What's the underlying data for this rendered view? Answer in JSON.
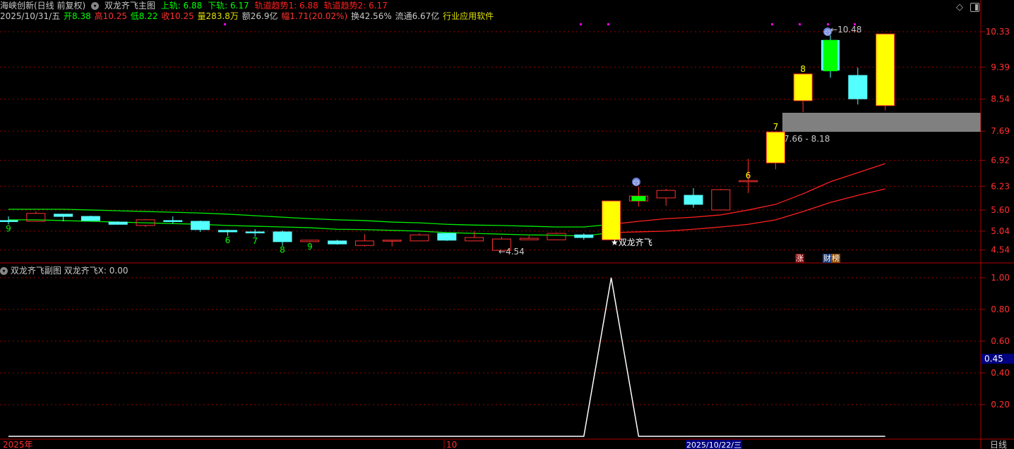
{
  "header": {
    "stock": "海峡创新(日线 前复权)",
    "indicator": "双龙齐飞主图",
    "upper": "上轨: 6.88",
    "lower": "下轨: 6.17",
    "trend1": "轨道趋势1: 6.88",
    "trend2": "轨道趋势2: 6.17",
    "date": "2025/10/31/五",
    "open": "开8.38",
    "high": "高10.25",
    "low": "低8.22",
    "close": "收10.25",
    "volume": "量283.8万",
    "amount": "额26.9亿",
    "change": "幅1.71(20.02%)",
    "turnover": "换42.56%",
    "float": "流通6.67亿",
    "industry": "行业应用软件"
  },
  "sub": {
    "title": "双龙齐飞副图",
    "value": "双龙齐飞X: 0.00"
  },
  "price_axis": [
    "10.33",
    "9.39",
    "8.54",
    "7.69",
    "6.92",
    "6.23",
    "5.60",
    "5.04",
    "4.54"
  ],
  "sub_axis": [
    "1.00",
    "0.80",
    "0.60",
    "0.40",
    "0.20"
  ],
  "sub_cursor": "0.45",
  "annotations": {
    "high_mark": "10.48",
    "low_mark": "4.54",
    "zone": "7.66 - 8.18",
    "signal": "★双龙齐飞",
    "tag_zhang": "涨",
    "tag_cai": "财",
    "tag_bang": "榜"
  },
  "time_axis": {
    "year": "2025年",
    "month": "10",
    "cursor_date": "2025/10/22/三",
    "period": "日线"
  },
  "colors": {
    "up": "#ff3030",
    "down": "#54ffff",
    "limit": "#ffff00",
    "special": "#00ff00",
    "ma_green": "#00ee00",
    "ma_red": "#ff2020"
  },
  "chart_data": {
    "type": "candlestick",
    "candles": [
      {
        "o": 5.32,
        "c": 5.3,
        "h": 5.43,
        "l": 5.22,
        "s": "down",
        "label": "9"
      },
      {
        "o": 5.3,
        "c": 5.51,
        "h": 5.56,
        "l": 5.3,
        "s": "up"
      },
      {
        "o": 5.49,
        "c": 5.43,
        "h": 5.49,
        "l": 5.3,
        "s": "down"
      },
      {
        "o": 5.43,
        "c": 5.32,
        "h": 5.45,
        "l": 5.32,
        "s": "down"
      },
      {
        "o": 5.28,
        "c": 5.22,
        "h": 5.3,
        "l": 5.22,
        "s": "down"
      },
      {
        "o": 5.19,
        "c": 5.34,
        "h": 5.36,
        "l": 5.15,
        "s": "up"
      },
      {
        "o": 5.32,
        "c": 5.3,
        "h": 5.43,
        "l": 5.24,
        "s": "down"
      },
      {
        "o": 5.3,
        "c": 5.08,
        "h": 5.32,
        "l": 5.02,
        "s": "down"
      },
      {
        "o": 5.06,
        "c": 5.02,
        "h": 5.08,
        "l": 4.91,
        "s": "down",
        "label": "6"
      },
      {
        "o": 5.02,
        "c": 5.0,
        "h": 5.09,
        "l": 4.89,
        "s": "down",
        "label": "7"
      },
      {
        "o": 5.02,
        "c": 4.76,
        "h": 5.06,
        "l": 4.65,
        "s": "down",
        "label": "8"
      },
      {
        "o": 4.76,
        "c": 4.8,
        "h": 4.81,
        "l": 4.74,
        "s": "up",
        "label": "9"
      },
      {
        "o": 4.78,
        "c": 4.7,
        "h": 4.81,
        "l": 4.68,
        "s": "down"
      },
      {
        "o": 4.66,
        "c": 4.78,
        "h": 4.96,
        "l": 4.63,
        "s": "up"
      },
      {
        "o": 4.78,
        "c": 4.8,
        "h": 4.81,
        "l": 4.63,
        "s": "up"
      },
      {
        "o": 4.78,
        "c": 4.94,
        "h": 4.98,
        "l": 4.78,
        "s": "up"
      },
      {
        "o": 4.98,
        "c": 4.8,
        "h": 4.98,
        "l": 4.78,
        "s": "down"
      },
      {
        "o": 4.78,
        "c": 4.87,
        "h": 5.04,
        "l": 4.78,
        "s": "up"
      },
      {
        "o": 4.53,
        "c": 4.83,
        "h": 4.89,
        "l": 4.53,
        "s": "up"
      },
      {
        "o": 4.81,
        "c": 4.85,
        "h": 4.92,
        "l": 4.81,
        "s": "up"
      },
      {
        "o": 4.81,
        "c": 4.98,
        "h": 5.0,
        "l": 4.81,
        "s": "up"
      },
      {
        "o": 4.94,
        "c": 4.87,
        "h": 4.98,
        "l": 4.81,
        "s": "down"
      },
      {
        "o": 4.81,
        "c": 5.84,
        "h": 5.84,
        "l": 4.81,
        "s": "limit"
      },
      {
        "o": 5.97,
        "c": 5.84,
        "h": 6.22,
        "l": 5.69,
        "s": "special"
      },
      {
        "o": 5.92,
        "c": 6.12,
        "h": 6.16,
        "l": 5.71,
        "s": "up"
      },
      {
        "o": 5.99,
        "c": 5.75,
        "h": 6.18,
        "l": 5.66,
        "s": "down"
      },
      {
        "o": 5.6,
        "c": 6.14,
        "h": 6.16,
        "l": 5.6,
        "s": "up"
      },
      {
        "o": 6.35,
        "c": 6.38,
        "h": 6.96,
        "l": 6.05,
        "s": "up",
        "label": "6"
      },
      {
        "o": 6.85,
        "c": 7.67,
        "h": 7.67,
        "l": 6.68,
        "s": "limit",
        "label": "7"
      },
      {
        "o": 8.5,
        "c": 9.21,
        "h": 9.21,
        "l": 8.2,
        "s": "limit",
        "label": "8"
      },
      {
        "o": 10.11,
        "c": 9.3,
        "h": 10.24,
        "l": 9.11,
        "s": "special2"
      },
      {
        "o": 9.17,
        "c": 8.55,
        "h": 9.38,
        "l": 8.4,
        "s": "down"
      },
      {
        "o": 8.37,
        "c": 10.27,
        "h": 10.27,
        "l": 8.24,
        "s": "limit"
      }
    ],
    "upper_track": [
      5.62,
      5.62,
      5.62,
      5.6,
      5.58,
      5.56,
      5.54,
      5.52,
      5.49,
      5.45,
      5.41,
      5.37,
      5.34,
      5.32,
      5.28,
      5.26,
      5.22,
      5.2,
      5.19,
      5.17,
      5.15,
      5.15,
      5.22,
      5.3,
      5.37,
      5.41,
      5.47,
      5.6,
      5.75,
      6.03,
      6.35,
      6.59,
      6.83
    ],
    "lower_track": [
      5.34,
      5.34,
      5.32,
      5.3,
      5.28,
      5.26,
      5.24,
      5.22,
      5.19,
      5.17,
      5.15,
      5.13,
      5.09,
      5.08,
      5.06,
      5.04,
      5.0,
      4.98,
      4.96,
      4.94,
      4.93,
      4.91,
      5.0,
      5.02,
      5.04,
      5.09,
      5.15,
      5.22,
      5.34,
      5.56,
      5.8,
      5.99,
      6.16
    ],
    "color_switch_index": 22,
    "sub_values": [
      0,
      0,
      0,
      0,
      0,
      0,
      0,
      0,
      0,
      0,
      0,
      0,
      0,
      0,
      0,
      0,
      0,
      0,
      0,
      0,
      0,
      0,
      1,
      0,
      0,
      0,
      0,
      0,
      0,
      0,
      0,
      0,
      0
    ],
    "price_range": [
      4.54,
      10.33
    ],
    "sub_range": [
      0,
      1
    ]
  }
}
